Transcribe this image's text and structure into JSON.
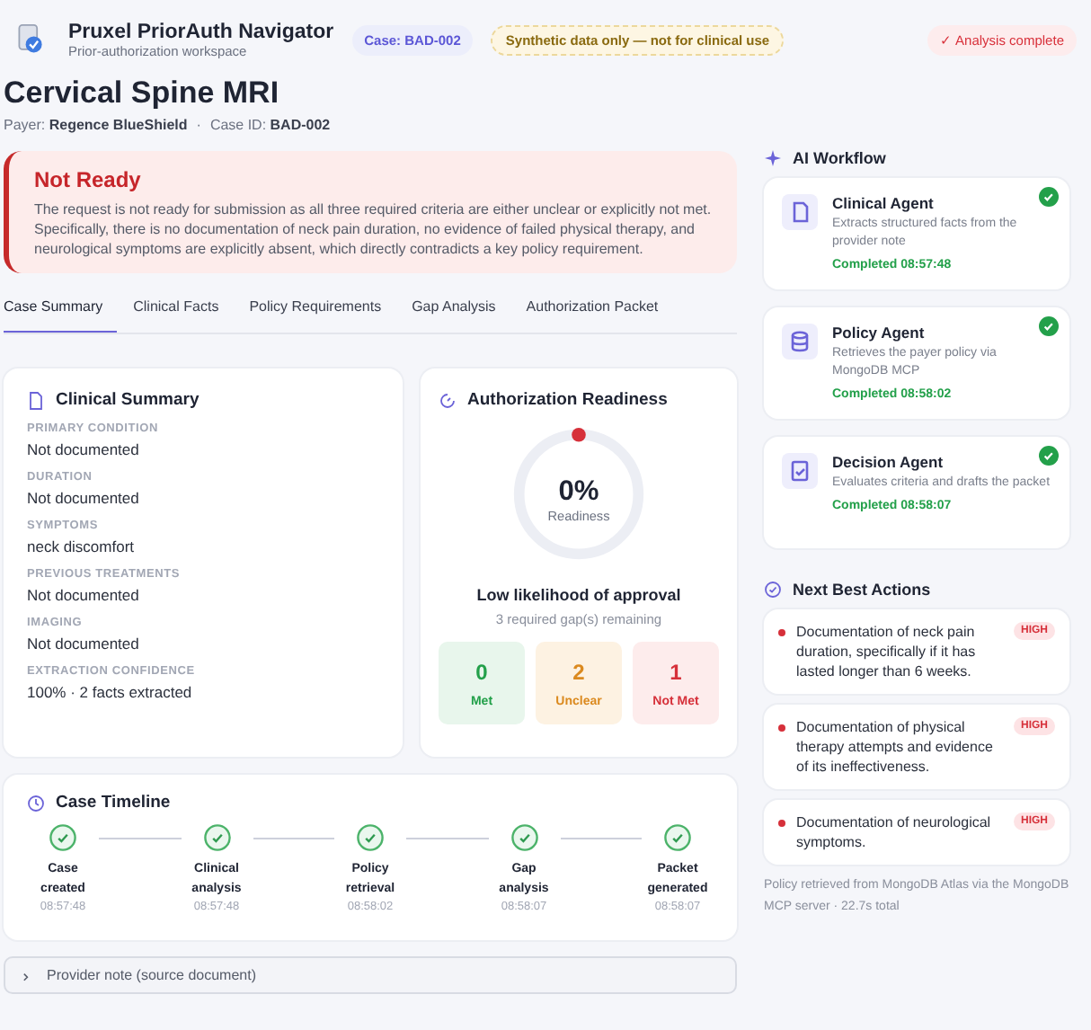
{
  "header": {
    "app_title": "Pruxel PriorAuth Navigator",
    "app_subtitle": "Prior-authorization workspace",
    "case_badge": "Case: BAD-002",
    "notice_badge": "Synthetic data only — not for clinical use",
    "status_badge": "✓ Analysis complete"
  },
  "case": {
    "title": "Cervical Spine MRI",
    "payer_label": "Payer:",
    "payer": "Regence BlueShield",
    "separator": "·",
    "case_id_label": "Case ID:",
    "case_id": "BAD-002"
  },
  "alert": {
    "title": "Not Ready",
    "message": "The request is not ready for submission as all three required criteria are either unclear or explicitly not met. Specifically, there is no documentation of neck pain duration, no evidence of failed physical therapy, and neurological symptoms are explicitly absent, which directly contradicts a key policy requirement."
  },
  "tabs": [
    {
      "label": "Case Summary",
      "selected": true
    },
    {
      "label": "Clinical Facts",
      "selected": false
    },
    {
      "label": "Policy Requirements",
      "selected": false
    },
    {
      "label": "Gap Analysis",
      "selected": false
    },
    {
      "label": "Authorization Packet",
      "selected": false
    }
  ],
  "clinical_summary": {
    "title": "Clinical Summary",
    "fields": [
      {
        "label": "PRIMARY CONDITION",
        "value": "Not documented"
      },
      {
        "label": "DURATION",
        "value": "Not documented"
      },
      {
        "label": "SYMPTOMS",
        "value": "neck discomfort"
      },
      {
        "label": "PREVIOUS TREATMENTS",
        "value": "Not documented"
      },
      {
        "label": "IMAGING",
        "value": "Not documented"
      },
      {
        "label": "EXTRACTION CONFIDENCE",
        "value": "100% · 2 facts extracted"
      }
    ]
  },
  "readiness": {
    "title": "Authorization Readiness",
    "percent": "0%",
    "caption": "Readiness",
    "verdict": "Low likelihood of approval",
    "gaps": "3 required gap(s) remaining",
    "counts": [
      {
        "kind": "met",
        "value": "0",
        "label": "Met"
      },
      {
        "kind": "unclear",
        "value": "2",
        "label": "Unclear"
      },
      {
        "kind": "not_met",
        "value": "1",
        "label": "Not Met"
      }
    ]
  },
  "timeline": {
    "title": "Case Timeline",
    "steps": [
      {
        "label": "Case created",
        "time": "08:57:48",
        "done": true
      },
      {
        "label": "Clinical analysis",
        "time": "08:57:48",
        "done": true
      },
      {
        "label": "Policy retrieval",
        "time": "08:58:02",
        "done": true
      },
      {
        "label": "Gap analysis",
        "time": "08:58:07",
        "done": true
      },
      {
        "label": "Packet generated",
        "time": "08:58:07",
        "done": true
      }
    ]
  },
  "provider_note": {
    "label": "Provider note (source document)",
    "expanded": false
  },
  "workflow": {
    "title": "AI Workflow",
    "agents": [
      {
        "kind": "clinical",
        "name": "Clinical Agent",
        "description": "Extracts structured facts from the provider note",
        "status": "Completed 08:57:48",
        "completed": true
      },
      {
        "kind": "policy",
        "name": "Policy Agent",
        "description": "Retrieves the payer policy via MongoDB MCP",
        "status": "Completed 08:58:02",
        "completed": true
      },
      {
        "kind": "decision",
        "name": "Decision Agent",
        "description": "Evaluates criteria and drafts the packet",
        "status": "Completed 08:58:07",
        "completed": true
      }
    ]
  },
  "next_actions": {
    "title": "Next Best Actions",
    "items": [
      {
        "text": "Documentation of neck pain duration, specifically if it has lasted longer than 6 weeks.",
        "priority": "HIGH"
      },
      {
        "text": "Documentation of physical therapy attempts and evidence of its ineffectiveness.",
        "priority": "HIGH"
      },
      {
        "text": "Documentation of neurological symptoms.",
        "priority": "HIGH"
      }
    ]
  },
  "footer_note": "Policy retrieved from MongoDB Atlas via the MongoDB MCP server · 22.7s total"
}
